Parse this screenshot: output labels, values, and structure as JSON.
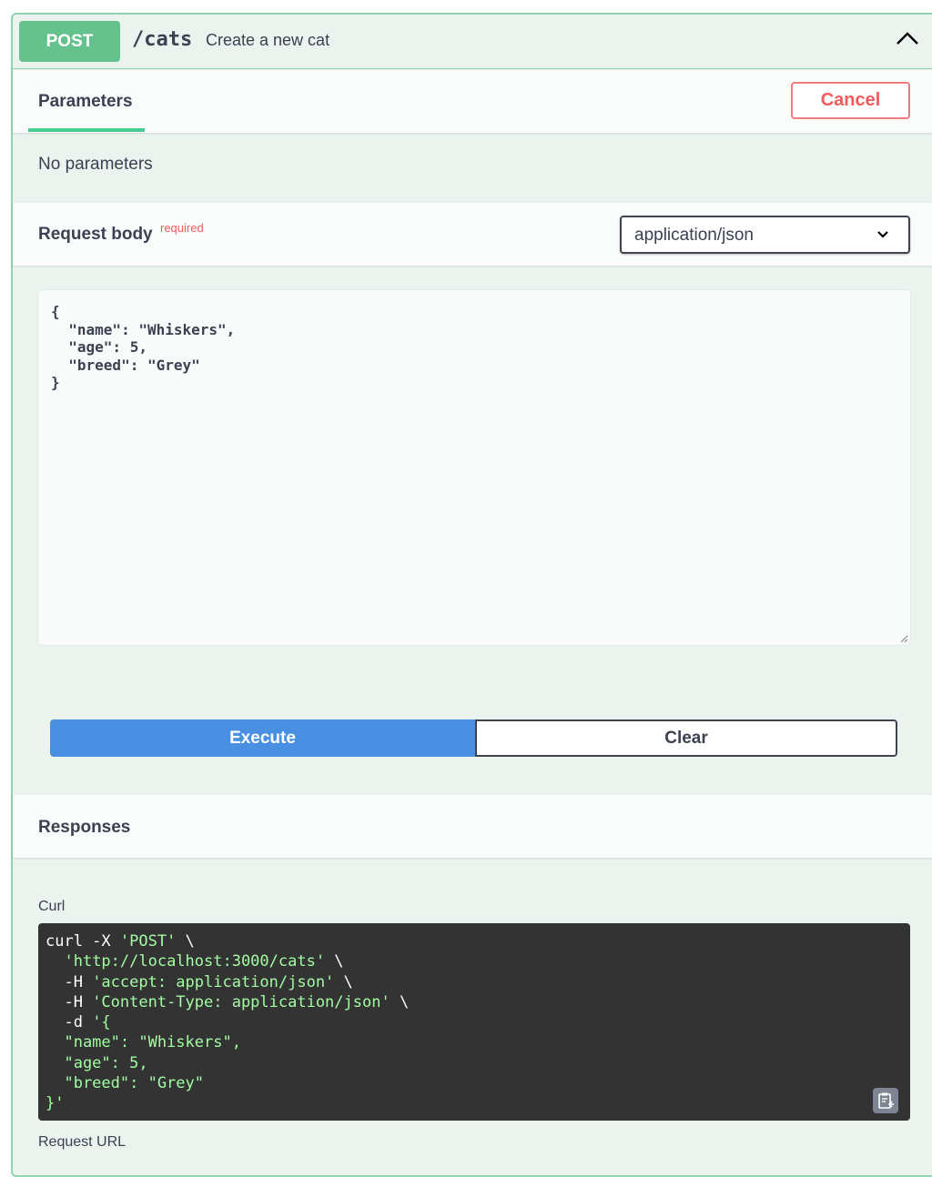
{
  "operation": {
    "method": "POST",
    "path": "/cats",
    "description": "Create a new cat",
    "collapse_icon": "chevron-up-icon"
  },
  "parameters": {
    "tab_label": "Parameters",
    "cancel_label": "Cancel",
    "empty_text": "No parameters"
  },
  "request_body": {
    "title": "Request body",
    "required_label": "required",
    "content_type": "application/json",
    "json_lines": [
      "{",
      "  \"name\": \"Whiskers\",",
      "  \"age\": 5,",
      "  \"breed\": \"Grey\"",
      "}"
    ]
  },
  "actions": {
    "execute_label": "Execute",
    "clear_label": "Clear"
  },
  "responses": {
    "title": "Responses",
    "curl_label": "Curl",
    "curl_lines": [
      [
        {
          "t": "curl -X "
        },
        {
          "t": "'POST'",
          "s": true
        },
        {
          "t": " \\"
        }
      ],
      [
        {
          "t": "  "
        },
        {
          "t": "'http://localhost:3000/cats'",
          "s": true
        },
        {
          "t": " \\"
        }
      ],
      [
        {
          "t": "  -H "
        },
        {
          "t": "'accept: application/json'",
          "s": true
        },
        {
          "t": " \\"
        }
      ],
      [
        {
          "t": "  -H "
        },
        {
          "t": "'Content-Type: application/json'",
          "s": true
        },
        {
          "t": " \\"
        }
      ],
      [
        {
          "t": "  -d "
        },
        {
          "t": "'{",
          "s": true
        }
      ],
      [
        {
          "t": "  \"name\": \"Whiskers\",",
          "s": true
        }
      ],
      [
        {
          "t": "  \"age\": 5,",
          "s": true
        }
      ],
      [
        {
          "t": "  \"breed\": \"Grey\"",
          "s": true
        }
      ],
      [
        {
          "t": "}'",
          "s": true
        }
      ]
    ],
    "copy_icon": "clipboard-copy-icon",
    "request_url_label": "Request URL"
  },
  "colors": {
    "post_green": "#49cc90",
    "execute_blue": "#4990e2",
    "cancel_red": "#f05c5c",
    "code_bg": "#333333",
    "code_string": "#a2fca2"
  }
}
